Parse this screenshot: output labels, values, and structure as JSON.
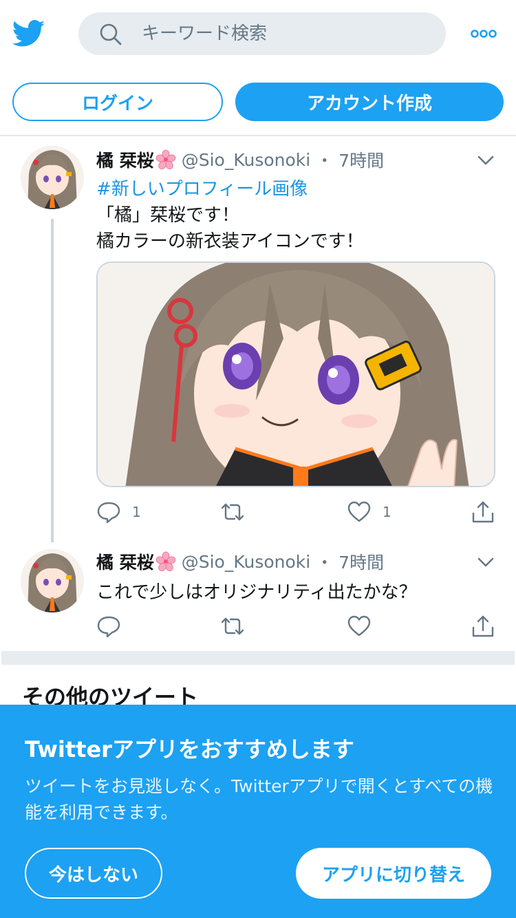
{
  "header": {
    "search_placeholder": "キーワード検索"
  },
  "auth": {
    "login_label": "ログイン",
    "signup_label": "アカウント作成"
  },
  "tweets": [
    {
      "name": "橘 栞桜",
      "handle": "@Sio_Kusonoki",
      "separator": "・",
      "time": "7時間",
      "hashtag": "#新しいプロフィール画像",
      "lines": [
        "「橘」栞桜です！",
        "橘カラーの新衣装アイコンです！"
      ],
      "reply_count": "1",
      "retweet_count": "",
      "like_count": "1"
    },
    {
      "name": "橘 栞桜",
      "handle": "@Sio_Kusonoki",
      "separator": "・",
      "time": "7時間",
      "lines": [
        "これで少しはオリジナリティ出たかな？"
      ],
      "reply_count": "",
      "retweet_count": "",
      "like_count": ""
    }
  ],
  "section": {
    "more_tweets_title": "その他のツイート"
  },
  "banner": {
    "title": "Twitterアプリをおすすめします",
    "body": "ツイートをお見逃しなく。Twitterアプリで開くとすべての機能を利用できます。",
    "later_label": "今はしない",
    "switch_label": "アプリに切り替え"
  },
  "colors": {
    "accent": "#1da1f2",
    "text_secondary": "#657786",
    "border": "#ccd6dd"
  }
}
